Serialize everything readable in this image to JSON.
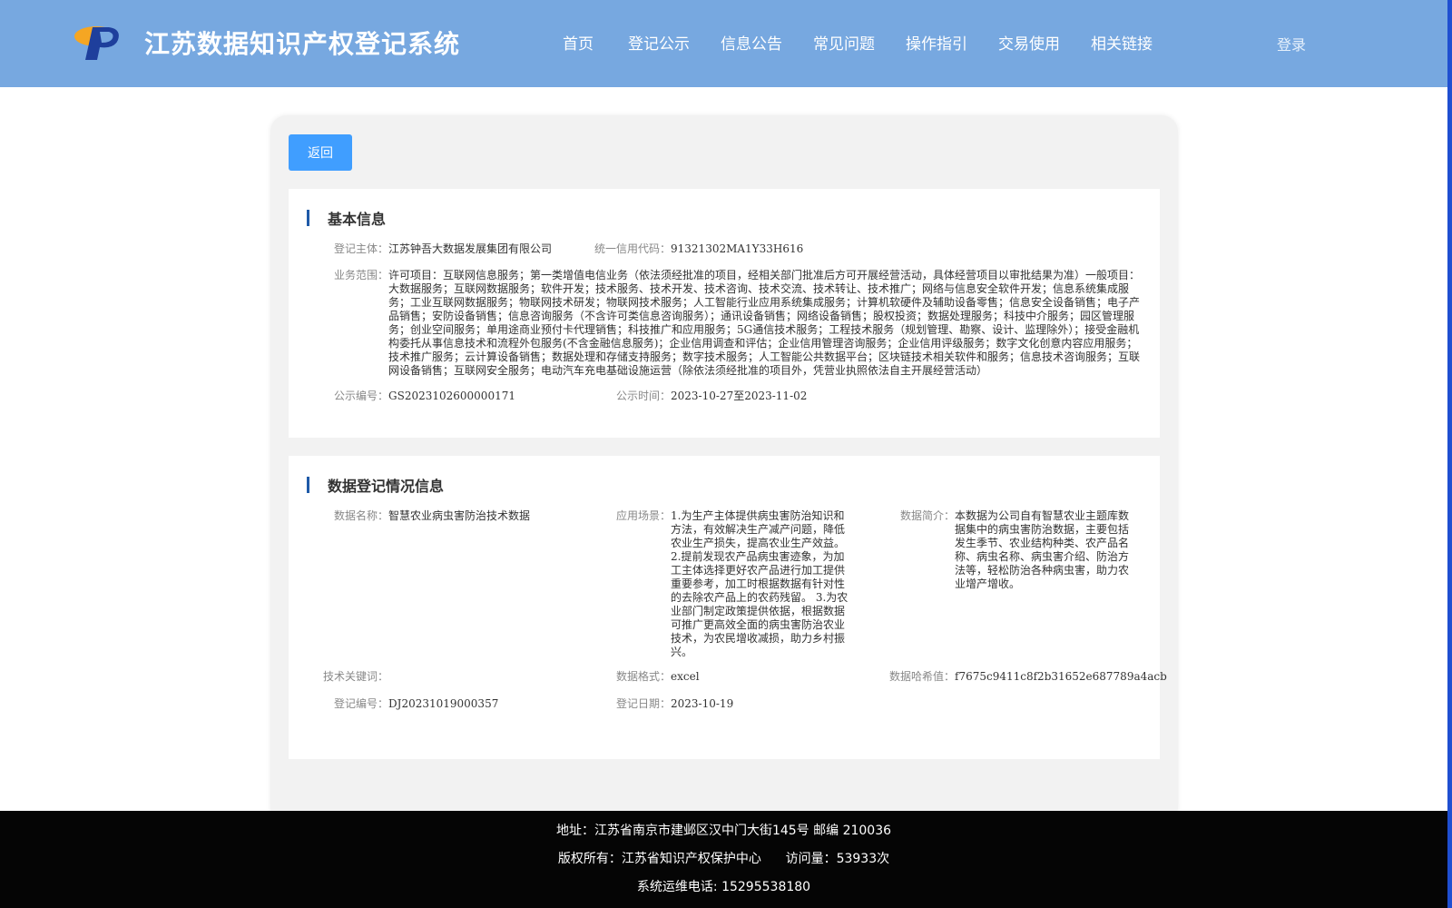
{
  "header": {
    "title": "江苏数据知识产权登记系统",
    "nav": [
      "首页",
      "登记公示",
      "信息公告",
      "常见问题",
      "操作指引",
      "交易使用",
      "相关链接"
    ],
    "login": "登录"
  },
  "back_label": "返回",
  "basic_info": {
    "section_title": "基本信息",
    "subject_label": "登记主体：",
    "subject_value": "江苏钟吾大数据发展集团有限公司",
    "credit_label": "统一信用代码：",
    "credit_value": "91321302MA1Y33H616",
    "scope_label": "业务范围：",
    "scope_value": "许可项目：互联网信息服务；第一类增值电信业务（依法须经批准的项目，经相关部门批准后方可开展经营活动，具体经营项目以审批结果为准）一般项目：大数据服务；互联网数据服务；软件开发；技术服务、技术开发、技术咨询、技术交流、技术转让、技术推广；网络与信息安全软件开发；信息系统集成服务；工业互联网数据服务；物联网技术研发；物联网技术服务；人工智能行业应用系统集成服务；计算机软硬件及辅助设备零售；信息安全设备销售；电子产品销售；安防设备销售；信息咨询服务（不含许可类信息咨询服务）；通讯设备销售；网络设备销售；股权投资；数据处理服务；科技中介服务；园区管理服务；创业空间服务；单用途商业预付卡代理销售；科技推广和应用服务；5G通信技术服务；工程技术服务（规划管理、勘察、设计、监理除外）；接受金融机构委托从事信息技术和流程外包服务(不含金融信息服务)；企业信用调查和评估；企业信用管理咨询服务；企业信用评级服务；数字文化创意内容应用服务；技术推广服务；云计算设备销售；数据处理和存储支持服务；数字技术服务；人工智能公共数据平台；区块链技术相关软件和服务；信息技术咨询服务；互联网设备销售；互联网安全服务；电动汽车充电基础设施运营（除依法须经批准的项目外，凭营业执照依法自主开展经营活动）",
    "notice_no_label": "公示编号：",
    "notice_no_value": "GS2023102600000171",
    "notice_time_label": "公示时间：",
    "notice_time_value": "2023-10-27至2023-11-02"
  },
  "data_info": {
    "section_title": "数据登记情况信息",
    "name_label": "数据名称：",
    "name_value": "智慧农业病虫害防治技术数据",
    "scene_label": "应用场景：",
    "scene_value": "1.为生产主体提供病虫害防治知识和方法，有效解决生产减产问题，降低农业生产损失，提高农业生产效益。 2.提前发现农产品病虫害迹象，为加工主体选择更好农产品进行加工提供重要参考，加工时根据数据有针对性的去除农产品上的农药残留。 3.为农业部门制定政策提供依据，根据数据可推广更高效全面的病虫害防治农业技术，为农民增收减损，助力乡村振兴。",
    "intro_label": "数据简介：",
    "intro_value": "本数据为公司自有智慧农业主题库数据集中的病虫害防治数据，主要包括发生季节、农业结构种类、农产品名称、病虫名称、病虫害介绍、防治方法等，轻松防治各种病虫害，助力农业增产增收。",
    "keyword_label": "技术关键词：",
    "keyword_value": "",
    "format_label": "数据格式：",
    "format_value": "excel",
    "hash_label": "数据哈希值：",
    "hash_value": "f7675c9411c8f2b31652e687789a4acb",
    "reg_no_label": "登记编号：",
    "reg_no_value": "DJ20231019000357",
    "reg_date_label": "登记日期：",
    "reg_date_value": "2023-10-19"
  },
  "footer": {
    "address": "地址：江苏省南京市建邺区汉中门大街145号 邮编 210036",
    "copyright": "版权所有：江苏省知识产权保护中心      访问量：53933次",
    "phone": "系统运维电话: 15295538180"
  },
  "colors": {
    "header_bg": "#77a8e0",
    "accent": "#409eff",
    "footer_bg": "#050505"
  }
}
